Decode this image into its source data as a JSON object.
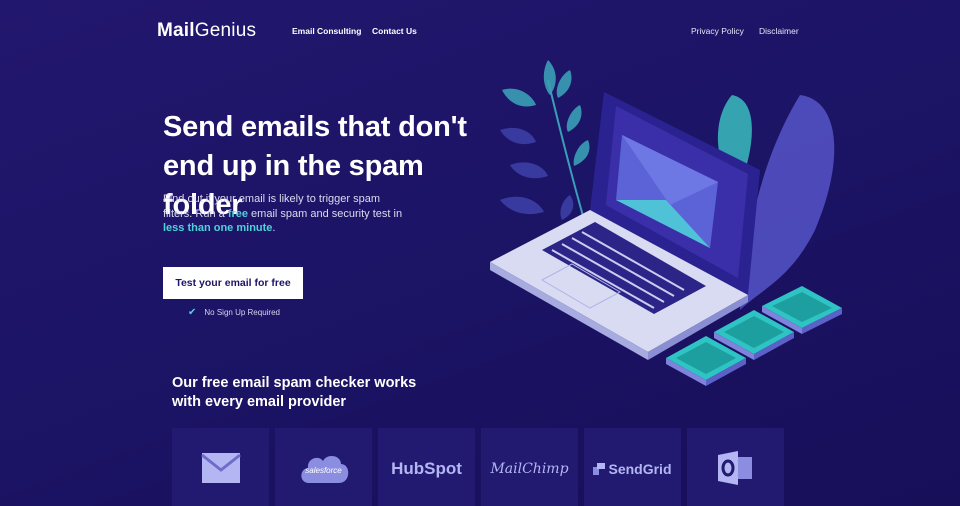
{
  "nav": {
    "logo_bold": "Mail",
    "logo_light": "Genius",
    "links_left": [
      "Email Consulting",
      "Contact Us"
    ],
    "links_right": [
      "Privacy Policy",
      "Disclaimer"
    ]
  },
  "hero": {
    "title_line1": "Send emails that don't",
    "title_line2": "end up in the spam folder",
    "sub_part1": "Find out if your email is likely to trigger spam filters. Run a ",
    "sub_free": "free",
    "sub_part2": " email spam and security test in ",
    "sub_fast": "less than one minute",
    "sub_end": ".",
    "cta_label": "Test your email for free",
    "no_signup": "No Sign Up Required"
  },
  "providers_section": {
    "title_line1": "Our free email spam checker works",
    "title_line2": "with every email provider",
    "providers": [
      {
        "name": "gmail",
        "icon": "mail-envelope-icon",
        "label": ""
      },
      {
        "name": "salesforce",
        "icon": "cloud-icon",
        "label": "salesforce"
      },
      {
        "name": "hubspot",
        "icon": "",
        "label": "HubSpot"
      },
      {
        "name": "mailchimp",
        "icon": "",
        "label": "MailChimp"
      },
      {
        "name": "sendgrid",
        "icon": "sendgrid-icon",
        "label": "SendGrid"
      },
      {
        "name": "outlook",
        "icon": "outlook-icon",
        "label": ""
      }
    ]
  },
  "colors": {
    "background": "#1c1466",
    "accent": "#4ed2d8",
    "card": "#221a70",
    "logo_tint": "#b4b6f4"
  }
}
